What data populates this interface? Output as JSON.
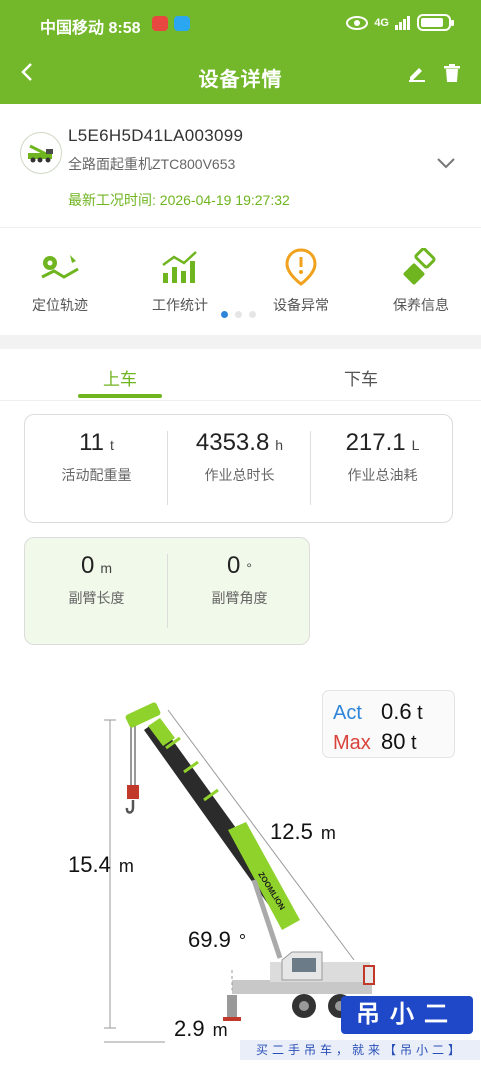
{
  "status_bar": {
    "carrier": "中国移动",
    "time": "8:58",
    "network": "4G"
  },
  "navbar": {
    "title": "设备详情"
  },
  "device": {
    "serial": "L5E6H5D41LA003099",
    "model": "全路面起重机ZTC800V653",
    "latest_label": "最新工况时间:",
    "latest_time": "2026-04-19 19:27:32"
  },
  "shortcuts": [
    {
      "label": "定位轨迹",
      "icon": "location-track-icon"
    },
    {
      "label": "工作统计",
      "icon": "work-stats-icon"
    },
    {
      "label": "设备异常",
      "icon": "alert-icon"
    },
    {
      "label": "保养信息",
      "icon": "maintenance-icon"
    }
  ],
  "tabs": [
    {
      "label": "上车",
      "active": true
    },
    {
      "label": "下车",
      "active": false
    }
  ],
  "stats": [
    {
      "value": "11",
      "unit": "t",
      "caption": "活动配重量"
    },
    {
      "value": "4353.8",
      "unit": "h",
      "caption": "作业总时长"
    },
    {
      "value": "217.1",
      "unit": "L",
      "caption": "作业总油耗"
    }
  ],
  "jib": [
    {
      "value": "0",
      "unit": "m",
      "caption": "副臂长度"
    },
    {
      "value": "0",
      "unit": "°",
      "caption": "副臂角度"
    }
  ],
  "load": {
    "act_label": "Act",
    "act_value": "0.6",
    "act_unit": "t",
    "max_label": "Max",
    "max_value": "80",
    "max_unit": "t"
  },
  "crane": {
    "height": "15.4",
    "height_unit": "m",
    "boom_length": "12.5",
    "boom_unit": "m",
    "angle": "69.9",
    "angle_unit": "°",
    "radius": "2.9",
    "radius_unit": "m",
    "brand": "ZOOMLION"
  },
  "watermark": {
    "title": "吊小二",
    "subtitle": "买二手吊车，就来【吊小二】"
  },
  "colors": {
    "primary": "#73b82a",
    "accent_text": "#6fb51f",
    "act": "#2d86d9",
    "max": "#d9433b",
    "boom": "#8fd22c",
    "boom_dark": "#2b2b2b"
  }
}
